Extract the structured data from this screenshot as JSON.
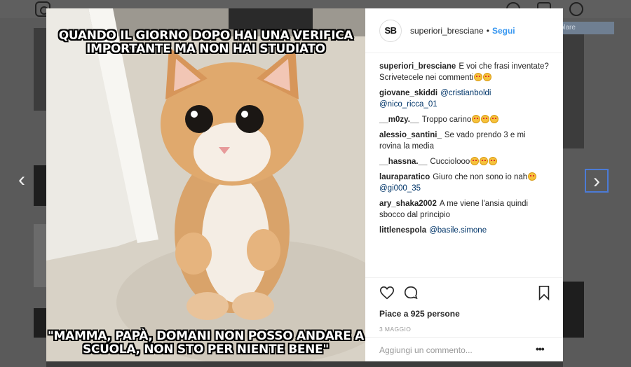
{
  "background": {
    "tooltip": "Cattura rettangolare"
  },
  "post": {
    "meme_top": "QUANDO IL GIORNO DOPO HAI UNA VERIFICA IMPORTANTE MA NON HAI STUDIATO",
    "meme_bottom": "\"MAMMA, PAPÀ, DOMANI NON POSSO ANDARE A SCUOLA, NON STO PER NIENTE BENE\""
  },
  "header": {
    "avatar_text": "SB",
    "username": "superiori_bresciane",
    "dot": "•",
    "follow_label": "Segui"
  },
  "comments": [
    {
      "user": "superiori_bresciane",
      "text": "E voi che frasi inventate? Scrivetecele nei commenti"
    },
    {
      "user": "giovane_skiddi",
      "mentions": "@cristianboldi @nico_ricca_01"
    },
    {
      "user": "__m0zy.__",
      "text": "Troppo carino"
    },
    {
      "user": "alessio_santini_",
      "text": "Se vado prendo 3 e mi rovina la media"
    },
    {
      "user": "__hassna.__",
      "text": "Cucciolooo"
    },
    {
      "user": "lauraparatico",
      "text": "Giuro che non sono io nah",
      "mention": "@gi000_35"
    },
    {
      "user": "ary_shaka2002",
      "text": "A me viene l'ansia quindi sbocco dal principio"
    },
    {
      "user": "littlenespola",
      "mention": "@basile.simone"
    }
  ],
  "actions": {
    "likes": "Piace a 925 persone",
    "date": "3 MAGGIO",
    "add_comment_placeholder": "Aggiungi un commento...",
    "more": "•••"
  },
  "icons": [
    "instagram-logo-icon",
    "compass-icon",
    "heart-icon",
    "profile-icon",
    "chevron-left-icon",
    "chevron-right-icon",
    "like-heart-icon",
    "comment-bubble-icon",
    "bookmark-icon"
  ],
  "colors": {
    "link": "#003569",
    "follow": "#3897f0",
    "nav_focus": "#4c7bd6"
  }
}
